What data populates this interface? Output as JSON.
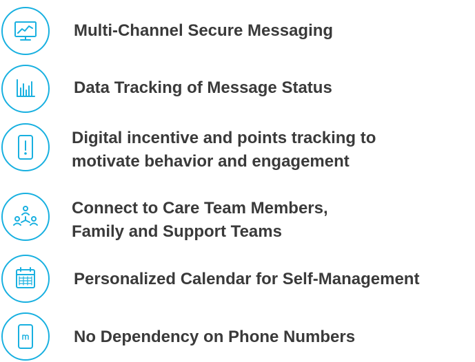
{
  "accent_color": "#18b0e0",
  "text_color": "#3a3a3a",
  "features": [
    {
      "icon": "monitor-chart-icon",
      "lines": [
        "Multi-Channel Secure Messaging"
      ]
    },
    {
      "icon": "bar-chart-icon",
      "lines": [
        "Data Tracking of Message Status"
      ]
    },
    {
      "icon": "phone-exclamation-icon",
      "lines": [
        "Digital incentive and points tracking to",
        "motivate behavior and engagement"
      ]
    },
    {
      "icon": "team-network-icon",
      "lines": [
        "Connect to Care Team Members,",
        "Family and Support Teams"
      ]
    },
    {
      "icon": "calendar-icon",
      "lines": [
        "Personalized Calendar for Self-Management"
      ]
    },
    {
      "icon": "phone-m-icon",
      "lines": [
        "No Dependency on Phone Numbers"
      ]
    }
  ]
}
